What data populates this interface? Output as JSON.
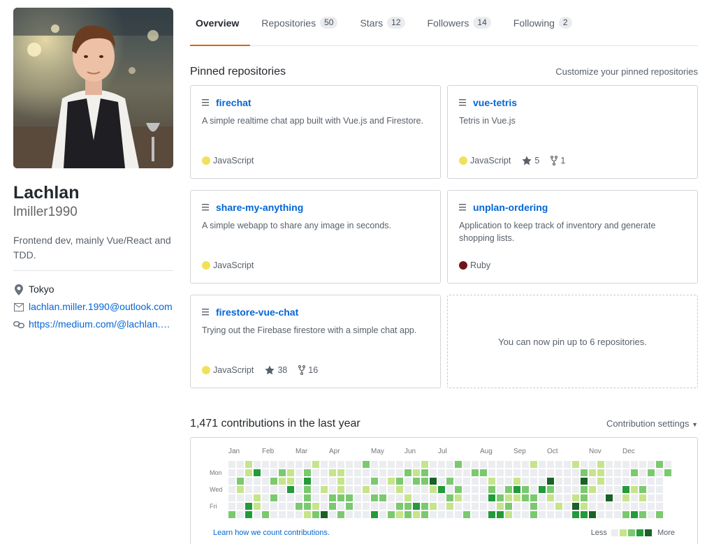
{
  "profile": {
    "fullname": "Lachlan",
    "username": "lmiller1990",
    "bio": "Frontend dev, mainly Vue/React and TDD.",
    "location": "Tokyo",
    "email": "lachlan.miller.1990@outlook.com",
    "website": "https://medium.com/@lachlan.miller"
  },
  "tabs": [
    {
      "label": "Overview",
      "count": ""
    },
    {
      "label": "Repositories",
      "count": "50"
    },
    {
      "label": "Stars",
      "count": "12"
    },
    {
      "label": "Followers",
      "count": "14"
    },
    {
      "label": "Following",
      "count": "2"
    }
  ],
  "pinned": {
    "title": "Pinned repositories",
    "customize": "Customize your pinned repositories",
    "placeholder": "You can now pin up to 6 repositories.",
    "repos": [
      {
        "name": "firechat",
        "description": "A simple realtime chat app built with Vue.js and Firestore.",
        "language": "JavaScript",
        "lang_color": "#f1e05a",
        "stars": "",
        "forks": ""
      },
      {
        "name": "vue-tetris",
        "description": "Tetris in Vue.js",
        "language": "JavaScript",
        "lang_color": "#f1e05a",
        "stars": "5",
        "forks": "1"
      },
      {
        "name": "share-my-anything",
        "description": "A simple webapp to share any image in seconds.",
        "language": "JavaScript",
        "lang_color": "#f1e05a",
        "stars": "",
        "forks": ""
      },
      {
        "name": "unplan-ordering",
        "description": "Application to keep track of inventory and generate shopping lists.",
        "language": "Ruby",
        "lang_color": "#701516",
        "stars": "",
        "forks": ""
      },
      {
        "name": "firestore-vue-chat",
        "description": "Trying out the Firebase firestore with a simple chat app.",
        "language": "JavaScript",
        "lang_color": "#f1e05a",
        "stars": "38",
        "forks": "16"
      }
    ]
  },
  "contributions": {
    "title": "1,471 contributions in the last year",
    "settings": "Contribution settings",
    "months": [
      "Jan",
      "Feb",
      "Mar",
      "Apr",
      "May",
      "Jun",
      "Jul",
      "Aug",
      "Sep",
      "Oct",
      "Nov",
      "Dec"
    ],
    "days": [
      "Mon",
      "Wed",
      "Fri"
    ],
    "learn": "Learn how we count contributions.",
    "less": "Less",
    "more": "More",
    "colors": [
      "#ebedf0",
      "#c6e48b",
      "#7bc96f",
      "#239a3b",
      "#196127"
    ]
  }
}
